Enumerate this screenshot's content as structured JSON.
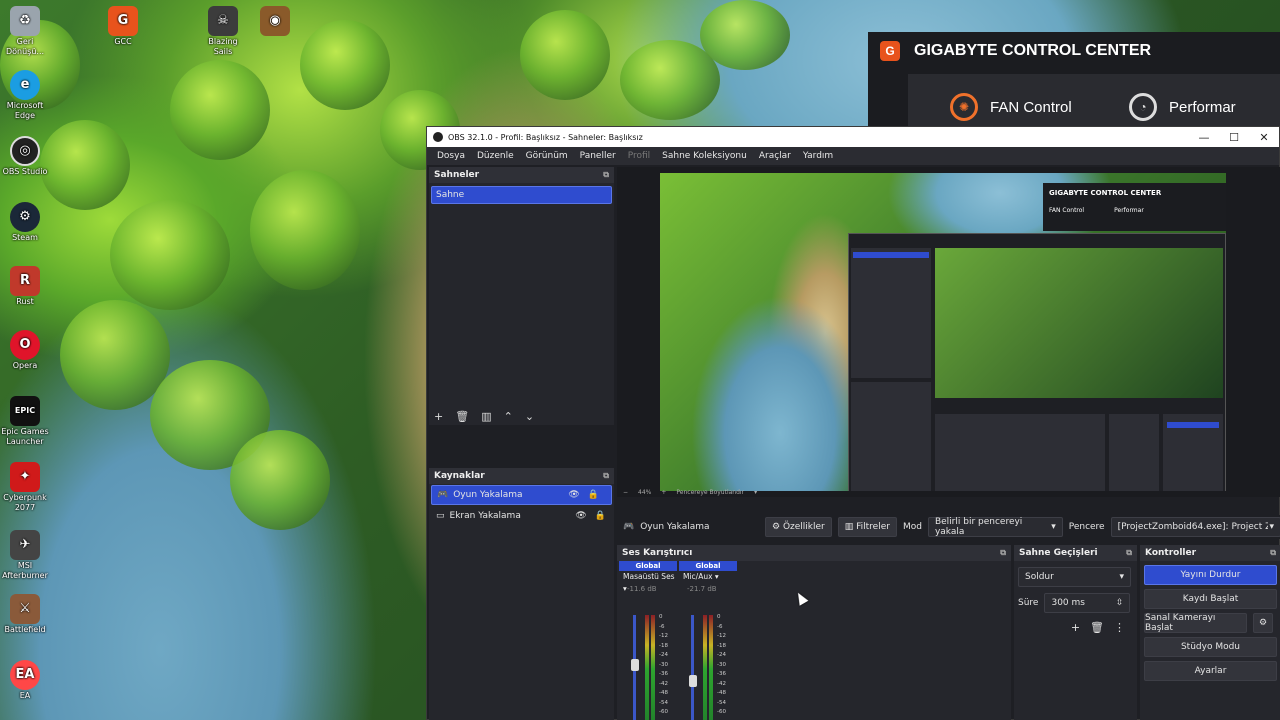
{
  "desktop": {
    "icons": [
      {
        "label": "Geri Dönüşü...",
        "icon": "recycle-bin-icon",
        "color": "#9aa4ad"
      },
      {
        "label": "GCC",
        "icon": "gcc-icon",
        "color": "#e8531c"
      },
      {
        "label": "Blazing Sails",
        "icon": "blazing-sails-icon",
        "color": "#3c3c3c"
      },
      {
        "label": "Microsoft Edge",
        "icon": "edge-icon",
        "color": "#1b9de2"
      },
      {
        "label": "OBS Studio",
        "icon": "obs-icon",
        "color": "#222222"
      },
      {
        "label": "Steam",
        "icon": "steam-icon",
        "color": "#1b2838"
      },
      {
        "label": "Rust",
        "icon": "rust-icon",
        "color": "#c0392b"
      },
      {
        "label": "Opera",
        "icon": "opera-icon",
        "color": "#e0142a"
      },
      {
        "label": "Epic Games Launcher",
        "icon": "epic-games-icon",
        "color": "#111111"
      },
      {
        "label": "Cyberpunk 2077",
        "icon": "cyberpunk-icon",
        "color": "#d01a1a"
      },
      {
        "label": "MSI Afterburner",
        "icon": "msi-afterburner-icon",
        "color": "#444444"
      },
      {
        "label": "Battlefield",
        "icon": "battlefield-icon",
        "color": "#8a5a3a"
      },
      {
        "label": "EA",
        "icon": "ea-icon",
        "color": "#ff4747"
      }
    ]
  },
  "gcc_window": {
    "title": "GIGABYTE CONTROL CENTER",
    "tabs": [
      "FAN Control",
      "Performar"
    ]
  },
  "obs": {
    "title": "OBS 32.1.0 - Profil: Başlıksız - Sahneler: Başlıksız",
    "menu": [
      "Dosya",
      "Düzenle",
      "Görünüm",
      "Paneller",
      "Profil",
      "Sahne Koleksiyonu",
      "Araçlar",
      "Yardım"
    ],
    "scenes": {
      "header": "Sahneler",
      "items": [
        "Sahne"
      ]
    },
    "sources": {
      "header": "Kaynaklar",
      "items": [
        {
          "label": "Oyun Yakalama",
          "selected": true
        },
        {
          "label": "Ekran Yakalama",
          "selected": false
        }
      ]
    },
    "preview": {
      "zoom": "44%",
      "resize_label": "Pencereye Boyutlandır"
    },
    "context_bar": {
      "source_name": "Oyun Yakalama",
      "properties": "Özellikler",
      "filters": "Filtreler",
      "mode_label": "Mod",
      "mode_value": "Belirli bir pencereyi yakala",
      "window_label": "Pencere",
      "window_value": "[ProjectZomboid64.exe]: Project Zom"
    },
    "mixer": {
      "header": "Ses Karıştırıcı",
      "channels": [
        {
          "badge": "Global",
          "name": "Masaüstü Ses",
          "db": "-11.6 dB",
          "level": 0.45,
          "fader": 0.62
        },
        {
          "badge": "Global",
          "name": "Mic/Aux",
          "db": "-21.7 dB",
          "level": 0.35,
          "fader": 0.45
        }
      ],
      "scale": [
        "0",
        "-6",
        "-12",
        "-18",
        "-24",
        "-30",
        "-36",
        "-42",
        "-48",
        "-54",
        "-60"
      ]
    },
    "transitions": {
      "header": "Sahne Geçişleri",
      "type": "Soldur",
      "duration_label": "Süre",
      "duration_value": "300 ms"
    },
    "controls": {
      "header": "Kontroller",
      "buttons": [
        "Yayını Durdur",
        "Kaydı Başlat",
        "Sanal Kamerayı Başlat",
        "Stüdyo Modu",
        "Ayarlar"
      ]
    },
    "nested_preview": {
      "gcc_title": "GIGABYTE CONTROL CENTER",
      "gcc_tab": "FAN Control",
      "gcc_tab2": "Performar"
    }
  }
}
